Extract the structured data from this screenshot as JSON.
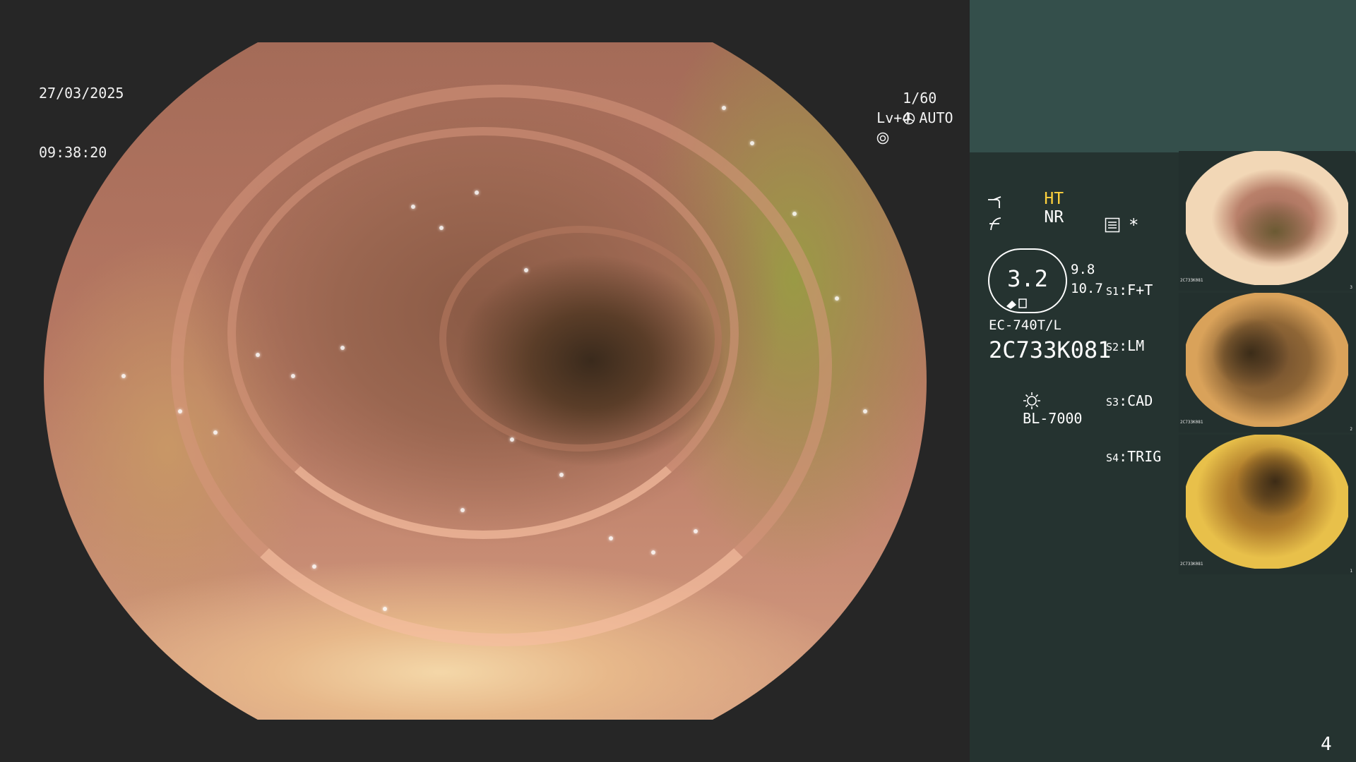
{
  "overlay": {
    "date": "27/03/2025",
    "time": "09:38:20",
    "shutter": "1/60",
    "level": "Lv+4 AUTO"
  },
  "panel": {
    "mode_ht": "HT",
    "mode_nr": "NR",
    "gauge_value": "3.2",
    "side_value_1": "9.8",
    "side_value_2": "10.7",
    "switches": [
      {
        "key": "S1",
        "value": "F+T"
      },
      {
        "key": "S2",
        "value": "LM"
      },
      {
        "key": "S3",
        "value": "CAD"
      },
      {
        "key": "S4",
        "value": "TRIG"
      }
    ],
    "scope_model": "EC-740T/L",
    "serial": "2C733K081",
    "light_source": "BL-7000",
    "asterisk": "*",
    "page_number": "4"
  },
  "thumbnails": [
    {
      "serial": "2C733K081",
      "index": "3"
    },
    {
      "serial": "2C733K081",
      "index": "2"
    },
    {
      "serial": "2C733K081",
      "index": "1"
    }
  ],
  "colors": {
    "background": "#262626",
    "panel": "#253330",
    "panel_header": "#344f4b",
    "highlight": "#ffd23d"
  },
  "icons": [
    "shutter-icon",
    "auto-iris-icon",
    "scope-curve-icon",
    "scope-angle-icon",
    "settings-icon",
    "light-source-icon"
  ]
}
